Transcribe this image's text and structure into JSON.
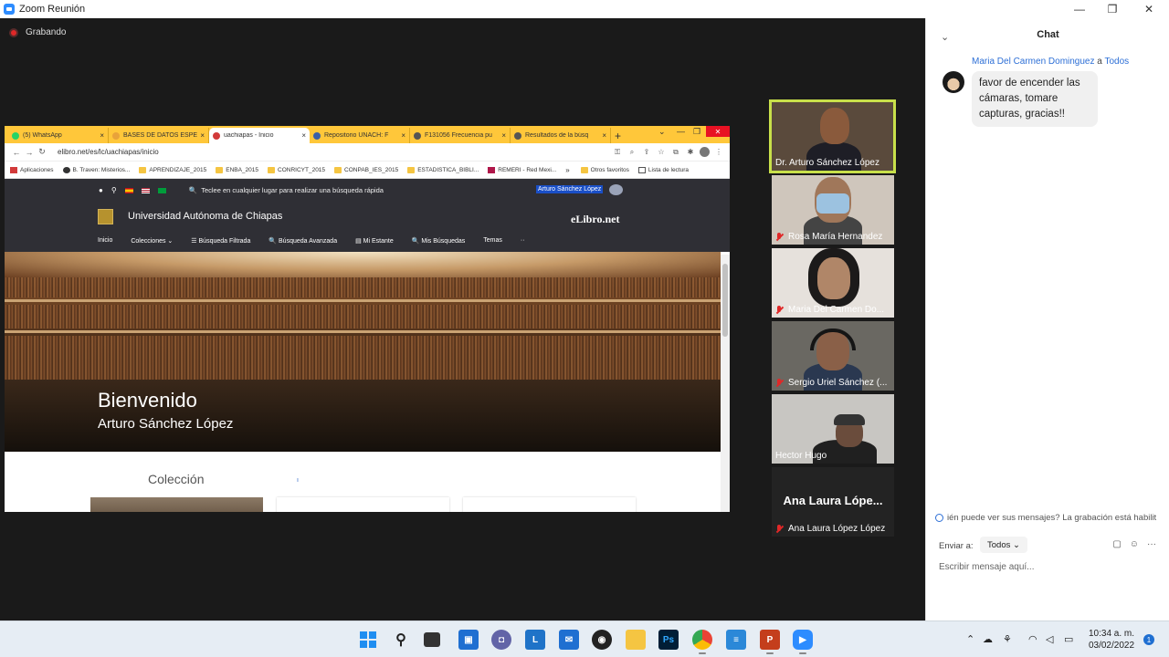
{
  "window": {
    "title": "Zoom Reunión",
    "minimize": "—",
    "maximize": "❐",
    "close": "✕"
  },
  "recording": {
    "label": "Grabando"
  },
  "browser": {
    "tabs": [
      {
        "label": "(5) WhatsApp",
        "icon_color": "#25d366"
      },
      {
        "label": "BASES DE DATOS ESPE",
        "icon_color": "#e8a33a"
      },
      {
        "label": "uachiapas - Inicio",
        "icon_color": "#d23a3a"
      },
      {
        "label": "Repositorio UNACH: F",
        "icon_color": "#3a5fa8"
      },
      {
        "label": "F131056 Frecuencia pu",
        "icon_color": "#555555"
      },
      {
        "label": "Resultados de la búsq",
        "icon_color": "#555555"
      }
    ],
    "tab_close": "×",
    "new_tab": "+",
    "url": "elibro.net/es/lc/uachiapas/inicio",
    "bookmarks": [
      {
        "label": "Aplicaciones",
        "color": "#d23a3a"
      },
      {
        "label": "B. Traven: Misterios...",
        "color": "#333333"
      },
      {
        "label": "APRENDIZAJE_2015",
        "color": "#f5c542"
      },
      {
        "label": "ENBA_2015",
        "color": "#f5c542"
      },
      {
        "label": "CONRICYT_2015",
        "color": "#f5c542"
      },
      {
        "label": "CONPAB_IES_2015",
        "color": "#f5c542"
      },
      {
        "label": "ESTADISTICA_BIBLI...",
        "color": "#f5c542"
      },
      {
        "label": "REMERI - Red Mexi...",
        "color": "#b0174a"
      }
    ],
    "bookmarks_more": "»",
    "other_favorites": "Otros favoritos",
    "reading_list": "Lista de lectura"
  },
  "site": {
    "search_hint": "Teclee en cualquier lugar para realizar una búsqueda rápida",
    "user": "Arturo Sánchez López",
    "university": "Universidad Autónoma de Chiapas",
    "brand": "eLibro.net",
    "menu": [
      "Inicio",
      "Colecciones ⌄",
      "☰ Búsqueda Filtrada",
      "🔍 Búsqueda Avanzada",
      "▤ Mi Estante",
      "🔍 Mis Búsquedas",
      "Temas",
      "··"
    ],
    "welcome": "Bienvenido",
    "welcome_name": "Arturo Sánchez López",
    "collection_title": "Colección",
    "collection_mark": "ı"
  },
  "participants": [
    {
      "name": "Dr. Arturo Sánchez López",
      "muted": false,
      "speaking": true
    },
    {
      "name": "Rosa María Hernandez",
      "muted": true
    },
    {
      "name": "Maria Del Carmen Do...",
      "muted": true
    },
    {
      "name": "Sergio Uriel Sánchez (...",
      "muted": true
    },
    {
      "name": "Hector Hugo",
      "muted": false
    },
    {
      "name": "Ana Laura López López",
      "muted": true,
      "display": "Ana Laura Lópe..."
    }
  ],
  "chat": {
    "title": "Chat",
    "collapse": "⌄",
    "sender": "Maria Del Carmen Dominguez",
    "to_word": "a",
    "recipient": "Todos",
    "message": "favor de encender las cámaras, tomare capturas, gracias!!",
    "notice": "ién puede ver sus mensajes? La grabación está habilit",
    "send_to_label": "Enviar a:",
    "send_to_value": "Todos ⌄",
    "input_placeholder": "Escribir mensaje aquí...",
    "tool_file": "▢",
    "tool_emoji": "☺",
    "tool_more": "···"
  },
  "taskbar": {
    "time": "10:34 a. m.",
    "date": "03/02/2022",
    "notifications": "1"
  }
}
